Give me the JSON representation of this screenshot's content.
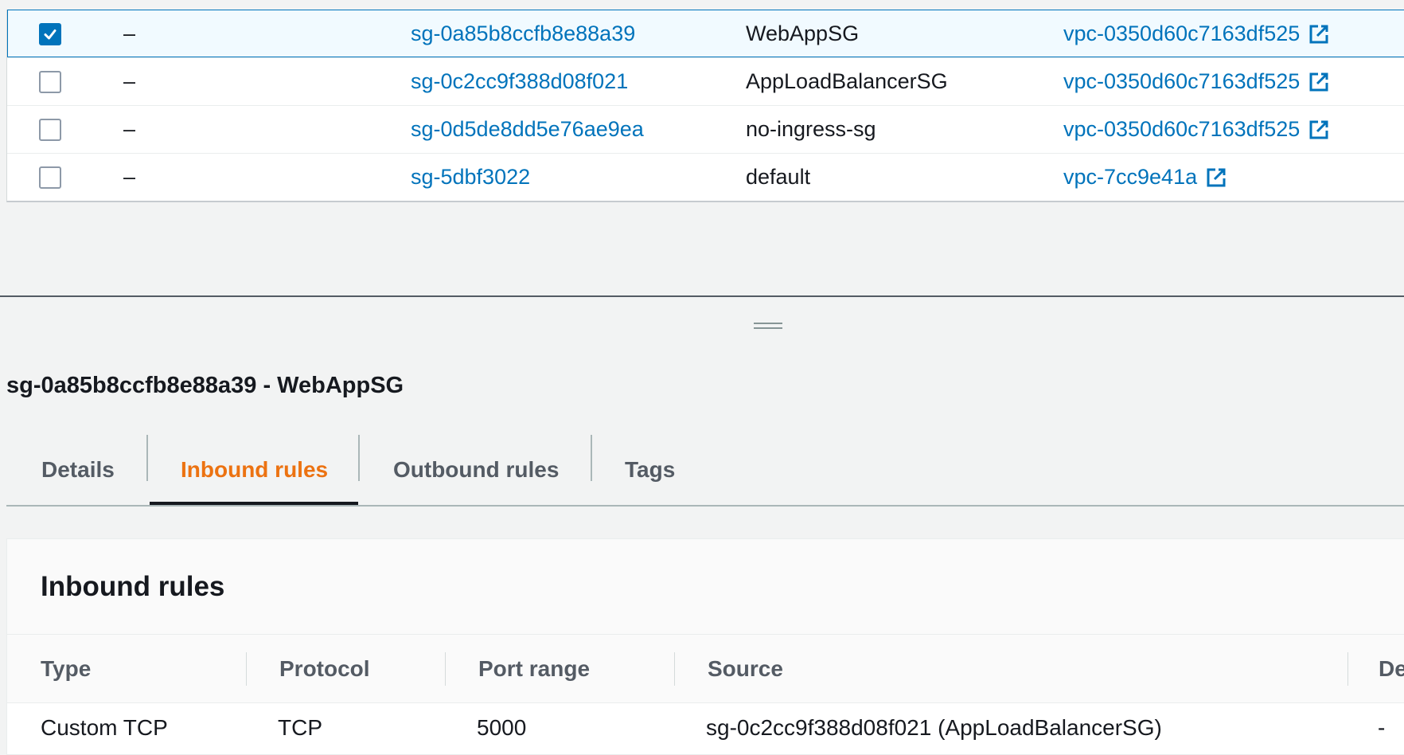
{
  "security_groups": [
    {
      "name": "–",
      "group_id": "sg-0a85b8ccfb8e88a39",
      "group_name": "WebAppSG",
      "vpc_id": "vpc-0350d60c7163df525",
      "selected": true
    },
    {
      "name": "–",
      "group_id": "sg-0c2cc9f388d08f021",
      "group_name": "AppLoadBalancerSG",
      "vpc_id": "vpc-0350d60c7163df525",
      "selected": false
    },
    {
      "name": "–",
      "group_id": "sg-0d5de8dd5e76ae9ea",
      "group_name": "no-ingress-sg",
      "vpc_id": "vpc-0350d60c7163df525",
      "selected": false
    },
    {
      "name": "–",
      "group_id": "sg-5dbf3022",
      "group_name": "default",
      "vpc_id": "vpc-7cc9e41a",
      "selected": false
    }
  ],
  "details": {
    "title": "sg-0a85b8ccfb8e88a39 - WebAppSG",
    "tabs": [
      "Details",
      "Inbound rules",
      "Outbound rules",
      "Tags"
    ],
    "active_tab": "Inbound rules"
  },
  "inbound": {
    "title": "Inbound rules",
    "columns": [
      "Type",
      "Protocol",
      "Port range",
      "Source",
      "De"
    ],
    "rows": [
      {
        "type": "Custom TCP",
        "protocol": "TCP",
        "port_range": "5000",
        "source": "sg-0c2cc9f388d08f021 (AppLoadBalancerSG)",
        "description": "-"
      }
    ]
  },
  "icons": {
    "checkbox_checked": "check-icon",
    "vpc_link": "external-link-icon",
    "splitter": "drag-handle-icon"
  },
  "colors": {
    "link": "#0073bb",
    "active_tab": "#ec7211",
    "selected_row": "#f1faff"
  }
}
